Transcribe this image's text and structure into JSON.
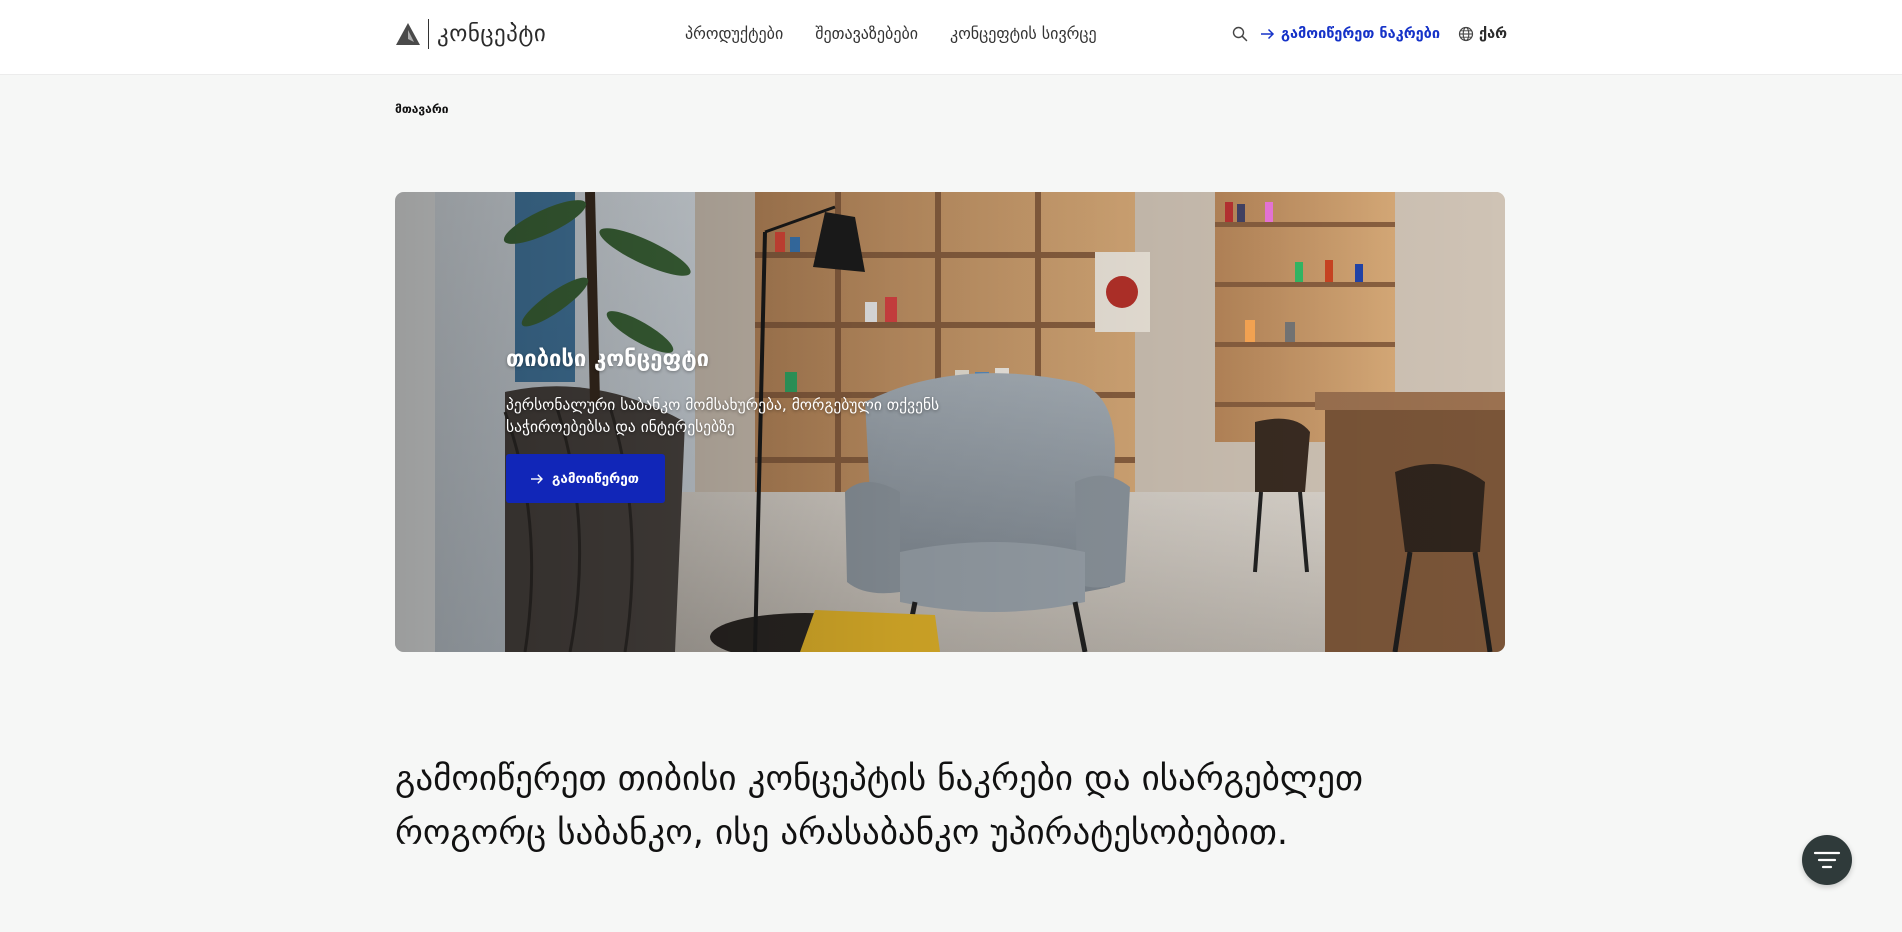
{
  "header": {
    "logo_text": "კონცეპტი",
    "nav": [
      {
        "label": "პროდუქტები"
      },
      {
        "label": "შეთავაზებები"
      },
      {
        "label": "კონცეფტის სივრცე"
      }
    ],
    "order_cards_label": "გამოიწერეთ ნაკრები",
    "language_label": "ქარ"
  },
  "breadcrumb": {
    "home": "მთავარი"
  },
  "hero": {
    "title": "თიბისი კონცეფტი",
    "subtitle": "პერსონალური საბანკო მომსახურება, მორგებული თქვენს საჭიროებებსა და ინტერესებზე",
    "button_label": "გამოიწერეთ"
  },
  "headline": "გამოიწერეთ თიბისი კონცეპტის ნაკრები და ისარგებლეთ როგორც საბანკო, ისე არასაბანკო უპირატესობებით.",
  "colors": {
    "accent": "#1532c8",
    "button_bg": "#1126b8",
    "fab_bg": "#2f3a3a",
    "page_bg": "#f6f7f6"
  },
  "icons": {
    "search": "search-icon",
    "arrow": "arrow-right-icon",
    "globe": "globe-icon",
    "filter": "filter-icon",
    "logo": "logo-mark-icon"
  }
}
